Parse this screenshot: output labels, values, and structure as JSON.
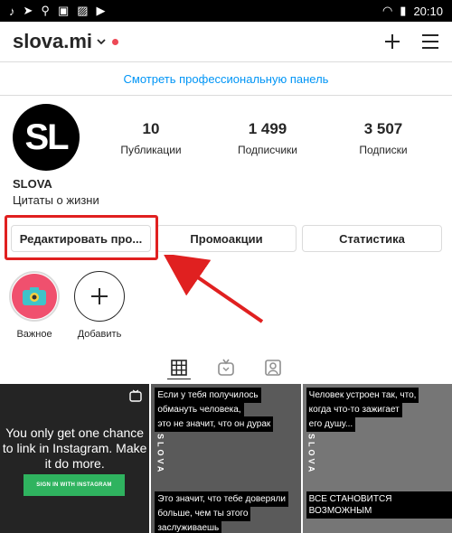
{
  "status_bar": {
    "time": "20:10"
  },
  "header": {
    "username": "slova.mi"
  },
  "pro_panel_link": "Смотреть профессиональную панель",
  "profile": {
    "avatar_initials": "SL",
    "name": "SLOVA",
    "bio": "Цитаты о жизни",
    "stats": [
      {
        "value": "10",
        "label": "Публикации"
      },
      {
        "value": "1 499",
        "label": "Подписчики"
      },
      {
        "value": "3 507",
        "label": "Подписки"
      }
    ]
  },
  "buttons": {
    "edit": "Редактировать про...",
    "promotions": "Промоакции",
    "statistics": "Статистика"
  },
  "highlights": [
    {
      "label": "Важное"
    },
    {
      "label": "Добавить"
    }
  ],
  "posts": {
    "p1": {
      "text": "You only get one chance to link in Instagram. Make it do more.",
      "button": "SIGN IN WITH INSTAGRAM"
    },
    "p2": {
      "caption_top_1": "Если у тебя получилось",
      "caption_top_2": "обмануть человека,",
      "caption_top_3": "это не значит, что он дурак",
      "caption_bot_1": "Это значит, что тебе доверяли",
      "caption_bot_2": "больше, чем ты этого",
      "caption_bot_3": "заслуживаешь",
      "side_text": "SLOVA"
    },
    "p3": {
      "caption_top_1": "Человек устроен так, что,",
      "caption_top_2": "когда что-то зажигает",
      "caption_top_3": "его душу...",
      "caption_bot_1": "ВСЕ СТАНОВИТСЯ ВОЗМОЖНЫМ",
      "side_text": "SLOVA"
    }
  },
  "colors": {
    "accent": "#0095f6",
    "notification_dot": "#ed4956",
    "annotation_red": "#e02020"
  }
}
